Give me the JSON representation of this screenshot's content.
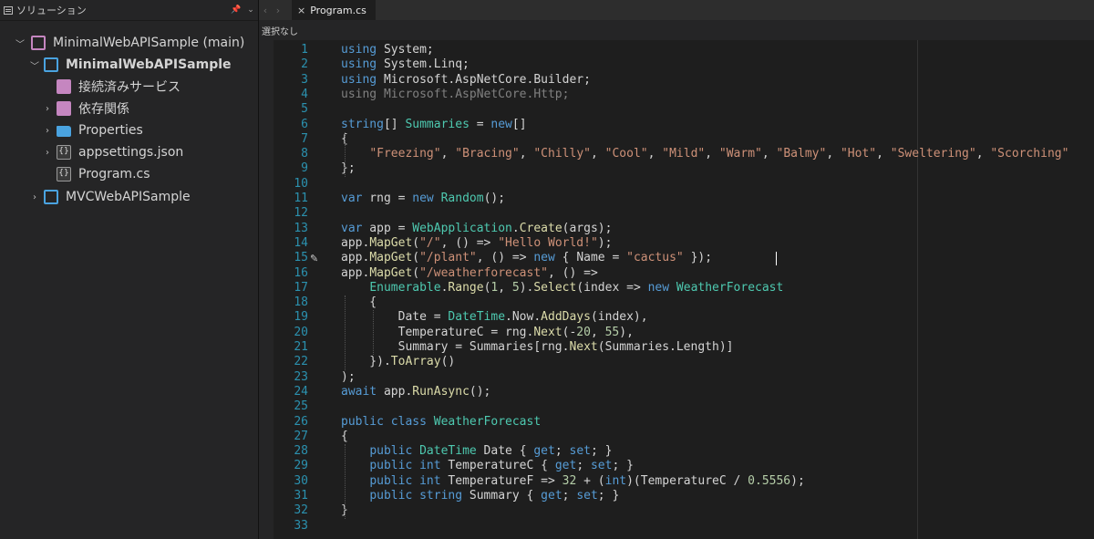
{
  "sidebar": {
    "title": "ソリューション",
    "pin_label": "📌",
    "menu_label": "⌄",
    "items": [
      {
        "label": "MinimalWebAPISample (main)",
        "bold": false
      },
      {
        "label": "MinimalWebAPISample",
        "bold": true
      },
      {
        "label": "接続済みサービス",
        "bold": false
      },
      {
        "label": "依存関係",
        "bold": false
      },
      {
        "label": "Properties",
        "bold": false
      },
      {
        "label": "appsettings.json",
        "bold": false
      },
      {
        "label": "Program.cs",
        "bold": false
      },
      {
        "label": "MVCWebAPISample",
        "bold": false
      }
    ],
    "icon_glyphs": {
      "json": "{}",
      "cs": "{}"
    }
  },
  "tabbar": {
    "back": "‹",
    "forward": "›",
    "tab_label": "Program.cs",
    "close": "×"
  },
  "navbar": {
    "selection": "選択なし"
  },
  "colors": {
    "keyword": "#569cd6",
    "type": "#4ec9b0",
    "method": "#dcdcaa",
    "string": "#ce9178",
    "number": "#b5cea8",
    "plain": "#d4d4d4",
    "faded": "#808080",
    "linenum": "#2b91af"
  },
  "code_lines": [
    [
      [
        "using",
        "k"
      ],
      [
        " System;",
        "p"
      ]
    ],
    [
      [
        "using",
        "k"
      ],
      [
        " System.Linq;",
        "p"
      ]
    ],
    [
      [
        "using",
        "k"
      ],
      [
        " Microsoft.AspNetCore.Builder;",
        "p"
      ]
    ],
    [
      [
        "using Microsoft.AspNetCore.Http;",
        "f"
      ]
    ],
    [],
    [
      [
        "string",
        "k"
      ],
      [
        "[] ",
        "p"
      ],
      [
        "Summaries",
        "t"
      ],
      [
        " = ",
        "p"
      ],
      [
        "new",
        "k"
      ],
      [
        "[]",
        "p"
      ]
    ],
    [
      [
        "{",
        "p"
      ]
    ],
    [
      [
        "    ",
        "p"
      ],
      [
        "\"Freezing\"",
        "s"
      ],
      [
        ", ",
        "p"
      ],
      [
        "\"Bracing\"",
        "s"
      ],
      [
        ", ",
        "p"
      ],
      [
        "\"Chilly\"",
        "s"
      ],
      [
        ", ",
        "p"
      ],
      [
        "\"Cool\"",
        "s"
      ],
      [
        ", ",
        "p"
      ],
      [
        "\"Mild\"",
        "s"
      ],
      [
        ", ",
        "p"
      ],
      [
        "\"Warm\"",
        "s"
      ],
      [
        ", ",
        "p"
      ],
      [
        "\"Balmy\"",
        "s"
      ],
      [
        ", ",
        "p"
      ],
      [
        "\"Hot\"",
        "s"
      ],
      [
        ", ",
        "p"
      ],
      [
        "\"Sweltering\"",
        "s"
      ],
      [
        ", ",
        "p"
      ],
      [
        "\"Scorching\"",
        "s"
      ]
    ],
    [
      [
        "};",
        "p"
      ]
    ],
    [],
    [
      [
        "var",
        "k"
      ],
      [
        " rng = ",
        "p"
      ],
      [
        "new",
        "k"
      ],
      [
        " ",
        "p"
      ],
      [
        "Random",
        "t"
      ],
      [
        "();",
        "p"
      ]
    ],
    [],
    [
      [
        "var",
        "k"
      ],
      [
        " app = ",
        "p"
      ],
      [
        "WebApplication",
        "t"
      ],
      [
        ".",
        "p"
      ],
      [
        "Create",
        "m"
      ],
      [
        "(args);",
        "p"
      ]
    ],
    [
      [
        "app.",
        "p"
      ],
      [
        "MapGet",
        "m"
      ],
      [
        "(",
        "p"
      ],
      [
        "\"/\"",
        "s"
      ],
      [
        ", () => ",
        "p"
      ],
      [
        "\"Hello World!\"",
        "s"
      ],
      [
        ");",
        "p"
      ]
    ],
    [
      [
        "app.",
        "p"
      ],
      [
        "MapGet",
        "m"
      ],
      [
        "(",
        "p"
      ],
      [
        "\"/plant\"",
        "s"
      ],
      [
        ", () => ",
        "p"
      ],
      [
        "new",
        "k"
      ],
      [
        " { Name = ",
        "p"
      ],
      [
        "\"cactus\"",
        "s"
      ],
      [
        " });",
        "p"
      ]
    ],
    [
      [
        "app.",
        "p"
      ],
      [
        "MapGet",
        "m"
      ],
      [
        "(",
        "p"
      ],
      [
        "\"/weatherforecast\"",
        "s"
      ],
      [
        ", () =>",
        "p"
      ]
    ],
    [
      [
        "    ",
        "p"
      ],
      [
        "Enumerable",
        "t"
      ],
      [
        ".",
        "p"
      ],
      [
        "Range",
        "m"
      ],
      [
        "(",
        "p"
      ],
      [
        "1",
        "n"
      ],
      [
        ", ",
        "p"
      ],
      [
        "5",
        "n"
      ],
      [
        ").",
        "p"
      ],
      [
        "Select",
        "m"
      ],
      [
        "(index => ",
        "p"
      ],
      [
        "new",
        "k"
      ],
      [
        " ",
        "p"
      ],
      [
        "WeatherForecast",
        "t"
      ]
    ],
    [
      [
        "    {",
        "p"
      ]
    ],
    [
      [
        "        Date = ",
        "p"
      ],
      [
        "DateTime",
        "t"
      ],
      [
        ".Now.",
        "p"
      ],
      [
        "AddDays",
        "m"
      ],
      [
        "(index),",
        "p"
      ]
    ],
    [
      [
        "        TemperatureC = rng.",
        "p"
      ],
      [
        "Next",
        "m"
      ],
      [
        "(-",
        "p"
      ],
      [
        "20",
        "n"
      ],
      [
        ", ",
        "p"
      ],
      [
        "55",
        "n"
      ],
      [
        "),",
        "p"
      ]
    ],
    [
      [
        "        Summary = Summaries[rng.",
        "p"
      ],
      [
        "Next",
        "m"
      ],
      [
        "(Summaries.Length)]",
        "p"
      ]
    ],
    [
      [
        "    }).",
        "p"
      ],
      [
        "ToArray",
        "m"
      ],
      [
        "()",
        "p"
      ]
    ],
    [
      [
        ");",
        "p"
      ]
    ],
    [
      [
        "await",
        "k"
      ],
      [
        " app.",
        "p"
      ],
      [
        "RunAsync",
        "m"
      ],
      [
        "();",
        "p"
      ]
    ],
    [],
    [
      [
        "public",
        "k"
      ],
      [
        " ",
        "p"
      ],
      [
        "class",
        "k"
      ],
      [
        " ",
        "p"
      ],
      [
        "WeatherForecast",
        "t"
      ]
    ],
    [
      [
        "{",
        "p"
      ]
    ],
    [
      [
        "    ",
        "p"
      ],
      [
        "public",
        "k"
      ],
      [
        " ",
        "p"
      ],
      [
        "DateTime",
        "t"
      ],
      [
        " Date { ",
        "p"
      ],
      [
        "get",
        "k"
      ],
      [
        "; ",
        "p"
      ],
      [
        "set",
        "k"
      ],
      [
        "; }",
        "p"
      ]
    ],
    [
      [
        "    ",
        "p"
      ],
      [
        "public",
        "k"
      ],
      [
        " ",
        "p"
      ],
      [
        "int",
        "k"
      ],
      [
        " TemperatureC { ",
        "p"
      ],
      [
        "get",
        "k"
      ],
      [
        "; ",
        "p"
      ],
      [
        "set",
        "k"
      ],
      [
        "; }",
        "p"
      ]
    ],
    [
      [
        "    ",
        "p"
      ],
      [
        "public",
        "k"
      ],
      [
        " ",
        "p"
      ],
      [
        "int",
        "k"
      ],
      [
        " TemperatureF => ",
        "p"
      ],
      [
        "32",
        "n"
      ],
      [
        " + (",
        "p"
      ],
      [
        "int",
        "k"
      ],
      [
        ")(TemperatureC / ",
        "p"
      ],
      [
        "0.5556",
        "n"
      ],
      [
        ");",
        "p"
      ]
    ],
    [
      [
        "    ",
        "p"
      ],
      [
        "public",
        "k"
      ],
      [
        " ",
        "p"
      ],
      [
        "string",
        "k"
      ],
      [
        " Summary { ",
        "p"
      ],
      [
        "get",
        "k"
      ],
      [
        "; ",
        "p"
      ],
      [
        "set",
        "k"
      ],
      [
        "; }",
        "p"
      ]
    ],
    [
      [
        "}",
        "p"
      ]
    ],
    []
  ]
}
